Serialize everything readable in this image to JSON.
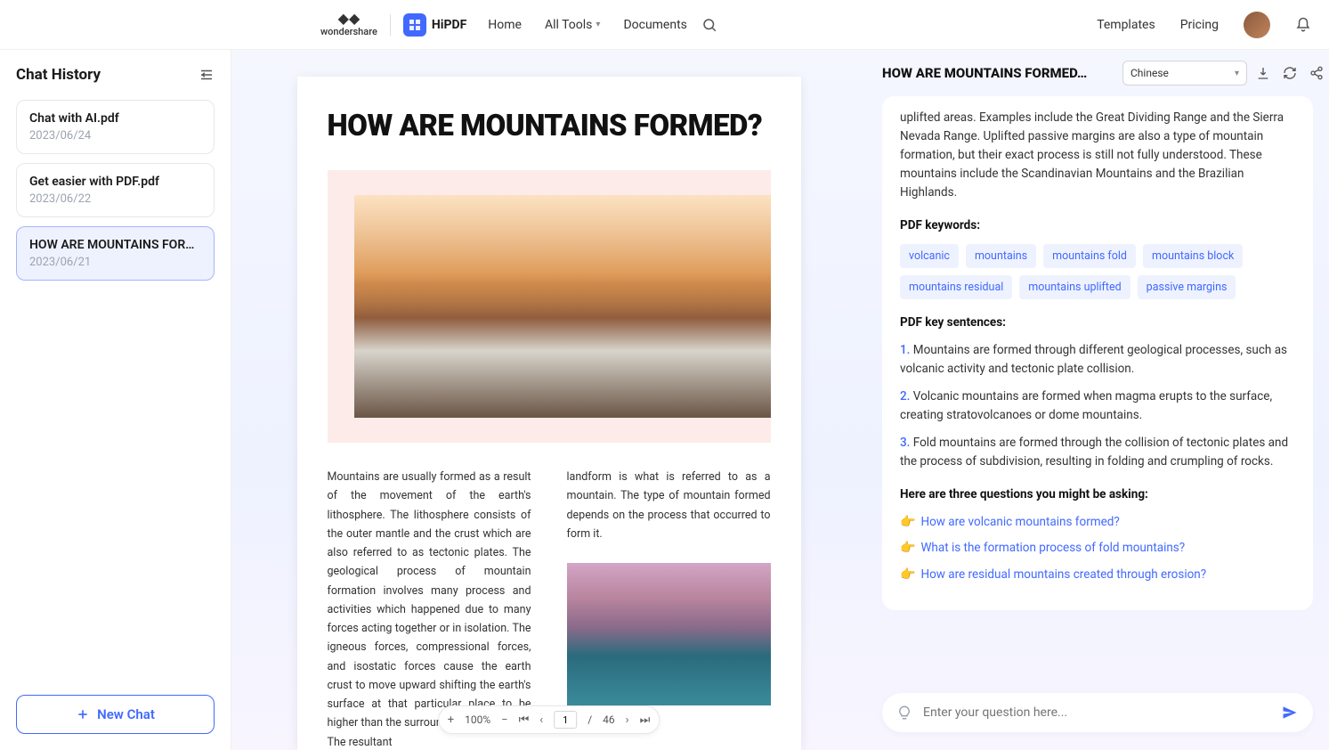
{
  "header": {
    "brand": "wondershare",
    "product": "HiPDF",
    "nav": {
      "home": "Home",
      "alltools": "All Tools",
      "documents": "Documents"
    },
    "templates": "Templates",
    "pricing": "Pricing"
  },
  "sidebar": {
    "title": "Chat History",
    "items": [
      {
        "name": "Chat with AI.pdf",
        "date": "2023/06/24"
      },
      {
        "name": "Get easier with PDF.pdf",
        "date": "2023/06/22"
      },
      {
        "name": "HOW ARE MOUNTAINS FORME…",
        "date": "2023/06/21"
      }
    ],
    "new_chat": "New Chat"
  },
  "doc": {
    "title": "HOW ARE MOUNTAINS FORMED?",
    "col1": "Mountains are usually formed as a result of the movement of the earth's lithosphere. The lithosphere consists of the outer mantle and the crust which are also referred to as tectonic plates. The geological process of mountain formation involves many process and activities which happened due to many forces acting together or in isolation. The igneous forces, compressional forces, and isostatic forces cause the earth crust to move upward shifting the earth's surface at that particular place to be higher than the surrounding environment. The resultant",
    "col2": "landform is what is referred to as a mountain. The type of mountain formed depends on the process that occurred to form it."
  },
  "page": {
    "zoom": "100%",
    "current": "1",
    "total": "46"
  },
  "panel": {
    "title": "HOW ARE MOUNTAINS FORMED…",
    "language": "Chinese",
    "summary": "uplifted areas. Examples include the Great Dividing Range and the Sierra Nevada Range. Uplifted passive margins are also a type of mountain formation, but their exact process is still not fully understood. These mountains include the Scandinavian Mountains and the Brazilian Highlands.",
    "kw_label": "PDF keywords:",
    "keywords": [
      "volcanic",
      "mountains",
      "mountains fold",
      "mountains block",
      "mountains residual",
      "mountains uplifted",
      "passive margins"
    ],
    "ks_label": "PDF key sentences:",
    "sentences": [
      "Mountains are formed through different geological processes, such as volcanic activity and tectonic plate collision.",
      "Volcanic mountains are formed when magma erupts to the surface, creating stratovolcanoes or dome mountains.",
      "Fold mountains are formed through the collision of tectonic plates and the process of subdivision, resulting in folding and crumpling of rocks."
    ],
    "q_label": "Here are three questions you might be asking:",
    "questions": [
      "How are volcanic mountains formed?",
      "What is the formation process of fold mountains?",
      "How are residual mountains created through erosion?"
    ],
    "input_placeholder": "Enter your question here..."
  }
}
